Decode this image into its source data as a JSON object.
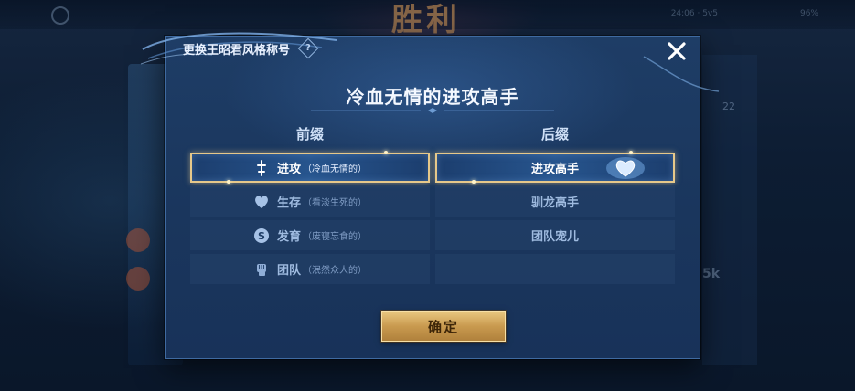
{
  "background": {
    "back_label": "关闭面板",
    "victory_text": "胜利",
    "top_info_left": "24:06 · 5v5",
    "top_info_right": "96%",
    "right_number": "22",
    "right_number2": "5k"
  },
  "dialog": {
    "title": "更换王昭君风格称号",
    "help_symbol": "?",
    "result_title": "冷血无情的进攻高手",
    "prefix_header": "前缀",
    "suffix_header": "后缀",
    "prefixes": [
      {
        "label": "进攻",
        "sub": "（冷血无情的）",
        "icon": "sword-icon",
        "selected": true
      },
      {
        "label": "生存",
        "sub": "（看淡生死的）",
        "icon": "heart-icon",
        "selected": false
      },
      {
        "label": "发育",
        "sub": "（废寝忘食的）",
        "icon": "coin-icon",
        "selected": false
      },
      {
        "label": "团队",
        "sub": "（泯然众人的）",
        "icon": "fist-icon",
        "selected": false
      }
    ],
    "suffixes": [
      {
        "label": "进攻高手",
        "selected": true
      },
      {
        "label": "驯龙高手",
        "selected": false
      },
      {
        "label": "团队宠儿",
        "selected": false
      },
      {
        "label": "",
        "selected": false
      }
    ],
    "confirm_label": "确定"
  },
  "colors": {
    "selected_border": "#e6c88a",
    "confirm_gold": "#c99a4f",
    "dialog_bg": "#1a365d"
  }
}
